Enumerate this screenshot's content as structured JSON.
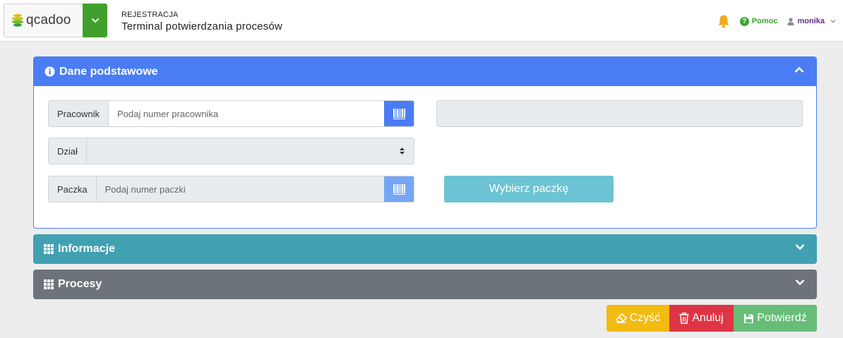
{
  "header": {
    "logo_text": "qcadoo",
    "section": "REJESTRACJA",
    "title": "Terminal potwierdzania procesów",
    "help_label": "Pomoc",
    "user_name": "monika"
  },
  "panels": {
    "basic": {
      "title": "Dane podstawowe",
      "icon": "info-circle-icon",
      "state": "expanded"
    },
    "info": {
      "title": "Informacje",
      "icon": "grid-icon",
      "state": "collapsed"
    },
    "processes": {
      "title": "Procesy",
      "icon": "grid-icon",
      "state": "collapsed"
    }
  },
  "form": {
    "worker": {
      "label": "Pracownik",
      "value": "",
      "placeholder": "Podaj numer pracownika"
    },
    "department": {
      "label": "Dział",
      "value": ""
    },
    "package": {
      "label": "Paczka",
      "value": "",
      "placeholder": "Podaj numer paczki"
    },
    "worker_details": "",
    "choose_package_label": "Wybierz paczkę"
  },
  "actions": {
    "clear_label": "Czyść",
    "cancel_label": "Anuluj",
    "confirm_label": "Potwierdź"
  },
  "colors": {
    "brand_green": "#41a02d",
    "primary": "#4a7df3",
    "info": "#41a0b2",
    "secondary": "#6c737b",
    "warning": "#f2bb12",
    "danger": "#de3545",
    "success": "#67bd78"
  }
}
